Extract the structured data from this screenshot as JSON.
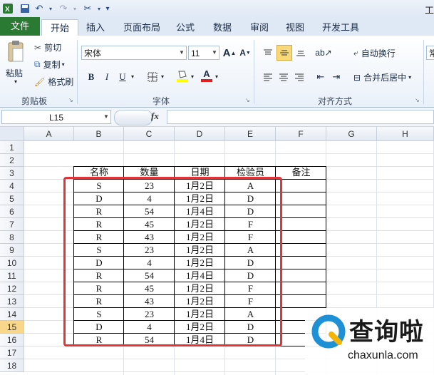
{
  "qat": {
    "title_char": "工"
  },
  "tabs": {
    "file": "文件",
    "items": [
      "开始",
      "插入",
      "页面布局",
      "公式",
      "数据",
      "审阅",
      "视图",
      "开发工具"
    ]
  },
  "ribbon": {
    "clipboard": {
      "paste": "粘贴",
      "cut": "剪切",
      "copy": "复制",
      "format_painter": "格式刷",
      "label": "剪贴板"
    },
    "font": {
      "name": "宋体",
      "size": "11",
      "bold": "B",
      "italic": "I",
      "underline": "U",
      "grow": "A",
      "shrink": "A",
      "color_letter": "A",
      "label": "字体"
    },
    "alignment": {
      "wrap": "自动换行",
      "merge": "合并后居中",
      "label": "对齐方式"
    },
    "number": {
      "format": "常"
    }
  },
  "formula_bar": {
    "name_box": "L15",
    "fx": "fx",
    "value": ""
  },
  "columns": [
    "A",
    "B",
    "C",
    "D",
    "E",
    "F",
    "G",
    "H"
  ],
  "rows": [
    "1",
    "2",
    "3",
    "4",
    "5",
    "6",
    "7",
    "8",
    "9",
    "10",
    "11",
    "12",
    "13",
    "14",
    "15",
    "16",
    "17",
    "18"
  ],
  "selected_row": "15",
  "table": {
    "headers": [
      "名称",
      "数量",
      "日期",
      "检验员",
      "备注"
    ],
    "rows": [
      [
        "S",
        "23",
        "1月2日",
        "A",
        ""
      ],
      [
        "D",
        "4",
        "1月2日",
        "D",
        ""
      ],
      [
        "R",
        "54",
        "1月4日",
        "D",
        ""
      ],
      [
        "R",
        "45",
        "1月2日",
        "F",
        ""
      ],
      [
        "R",
        "43",
        "1月2日",
        "F",
        ""
      ],
      [
        "S",
        "23",
        "1月2日",
        "A",
        ""
      ],
      [
        "D",
        "4",
        "1月2日",
        "D",
        ""
      ],
      [
        "R",
        "54",
        "1月4日",
        "D",
        ""
      ],
      [
        "R",
        "45",
        "1月2日",
        "F",
        ""
      ],
      [
        "R",
        "43",
        "1月2日",
        "F",
        ""
      ],
      [
        "S",
        "23",
        "1月2日",
        "A",
        ""
      ],
      [
        "D",
        "4",
        "1月2日",
        "D",
        ""
      ],
      [
        "R",
        "54",
        "1月4日",
        "D",
        ""
      ]
    ]
  },
  "watermark": {
    "title": "查询啦",
    "url": "chaxunla.com"
  },
  "colors": {
    "highlight": "#e0333a",
    "file_tab": "#2a7a34",
    "selected_row_header": "#f9d78a"
  }
}
